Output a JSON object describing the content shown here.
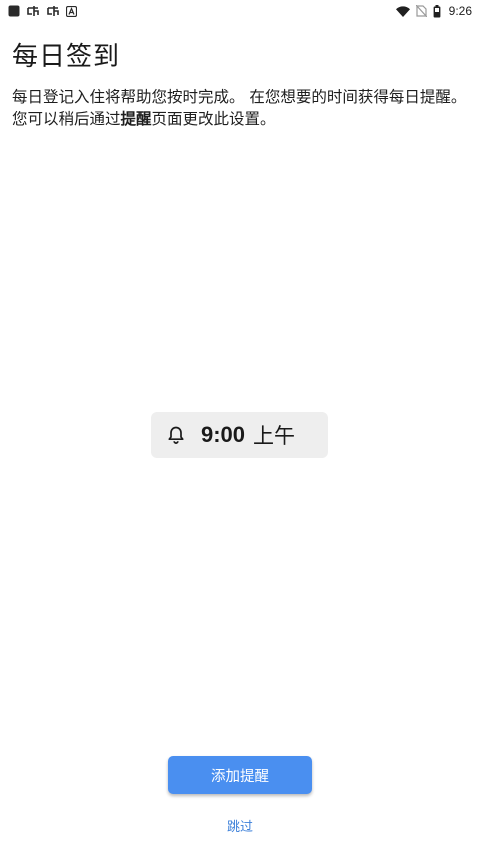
{
  "status_bar": {
    "time": "9:26",
    "left_icons": [
      "app-square-icon",
      "notification-app-icon",
      "notification-app-icon",
      "notification-a-icon"
    ],
    "right_icons": [
      "wifi-icon",
      "no-sim-icon",
      "battery-icon"
    ]
  },
  "page": {
    "title": "每日签到",
    "description_part1": "每日登记入住将帮助您按时完成。 在您想要的时间获得每日提醒。 您可以稍后通过",
    "description_bold": "提醒",
    "description_part2": "页面更改此设置。"
  },
  "reminder": {
    "time": "9:00",
    "period": "上午",
    "icon": "bell-icon"
  },
  "actions": {
    "add_label": "添加提醒",
    "skip_label": "跳过"
  },
  "colors": {
    "primary": "#4a8ff0",
    "link": "#3b7fd9",
    "chip_bg": "#eeeeee"
  }
}
